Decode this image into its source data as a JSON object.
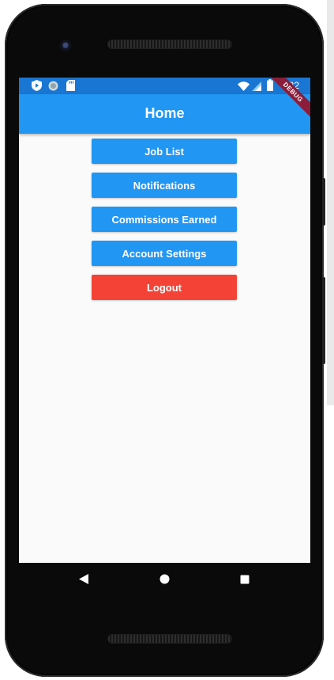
{
  "status_bar": {
    "time": "5:32",
    "left_icons": [
      "play-protect-icon",
      "circle-icon",
      "sd-card-icon"
    ],
    "right_icons": [
      "wifi-icon",
      "cell-signal-icon",
      "battery-icon"
    ]
  },
  "debug_banner": {
    "label": "DEBUG"
  },
  "app_bar": {
    "title": "Home"
  },
  "menu": {
    "job_list": "Job List",
    "notifications": "Notifications",
    "commissions": "Commissions Earned",
    "account_settings": "Account Settings",
    "logout": "Logout"
  },
  "nav_bar": {
    "icons": [
      "back-icon",
      "home-icon",
      "recents-icon"
    ]
  },
  "colors": {
    "status_bar": "#1976d2",
    "app_bar": "#2196f3",
    "primary_button": "#2196f3",
    "logout_button": "#f44336",
    "screen_background": "#fafafa",
    "device_body": "#0a0a0a"
  }
}
